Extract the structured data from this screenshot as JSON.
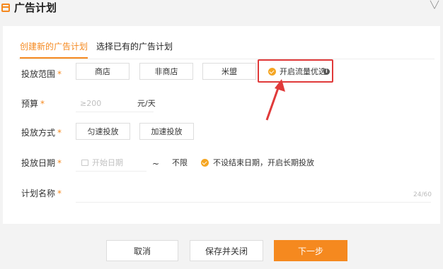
{
  "header": {
    "title": "广告计划"
  },
  "tabs": [
    {
      "label": "创建新的广告计划",
      "active": true
    },
    {
      "label": "选择已有的广告计划",
      "active": false
    }
  ],
  "form": {
    "placement_range": {
      "label": "投放范围",
      "options": [
        "商店",
        "非商店",
        "米盟"
      ],
      "optimize_label": "开启流量优选"
    },
    "budget": {
      "label": "预算",
      "placeholder": "≥200",
      "unit": "元/天"
    },
    "delivery_mode": {
      "label": "投放方式",
      "options": [
        "匀速投放",
        "加速投放"
      ]
    },
    "delivery_date": {
      "label": "投放日期",
      "start_placeholder": "开始日期",
      "separator": "~",
      "end_value": "不限",
      "no_end_label": "不设结束日期，开启长期投放"
    },
    "plan_name": {
      "label": "计划名称",
      "counter": "24/60"
    },
    "required_mark": "*"
  },
  "footer": {
    "cancel": "取消",
    "save_close": "保存并关闭",
    "next": "下一步"
  },
  "colors": {
    "accent": "#f5891f",
    "highlight_box": "#e03a3a",
    "arrow": "#e03a3a"
  },
  "icons": [
    "calendar-header-icon",
    "chevron-icon",
    "check-circle-icon",
    "info-icon",
    "calendar-icon",
    "annotation-arrow"
  ]
}
